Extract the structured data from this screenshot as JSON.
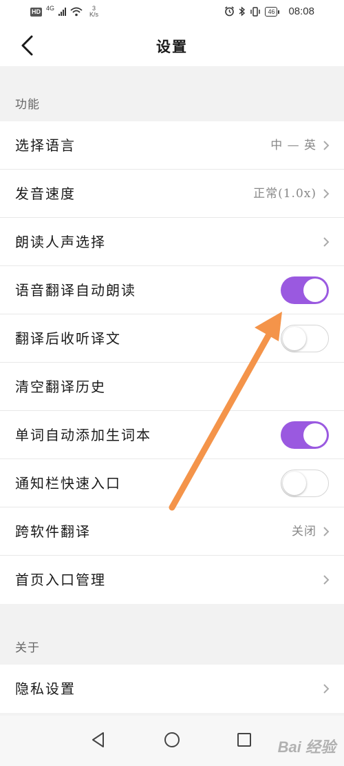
{
  "status_bar": {
    "hd": "HD",
    "network": "4G",
    "speed_value": "3",
    "speed_unit": "K/s",
    "battery": "46",
    "time": "08:08"
  },
  "header": {
    "title": "设置"
  },
  "sections": [
    {
      "title": "功能",
      "items": [
        {
          "label": "选择语言",
          "value": "中 — 英",
          "chevron": true
        },
        {
          "label": "发音速度",
          "value": "正常(1.0x)",
          "chevron": true
        },
        {
          "label": "朗读人声选择",
          "value": "",
          "chevron": true
        },
        {
          "label": "语音翻译自动朗读",
          "toggle": true,
          "on": true
        },
        {
          "label": "翻译后收听译文",
          "toggle": true,
          "on": false
        },
        {
          "label": "清空翻译历史"
        },
        {
          "label": "单词自动添加生词本",
          "toggle": true,
          "on": true
        },
        {
          "label": "通知栏快速入口",
          "toggle": true,
          "on": false
        },
        {
          "label": "跨软件翻译",
          "value": "关闭",
          "chevron": true
        },
        {
          "label": "首页入口管理",
          "value": "",
          "chevron": true
        }
      ]
    },
    {
      "title": "关于",
      "items": [
        {
          "label": "隐私设置",
          "value": "",
          "chevron": true
        }
      ]
    }
  ],
  "colors": {
    "toggle_on": "#9a59e0",
    "annotation_arrow": "#f4944a"
  },
  "nav_icons": [
    "back-triangle-icon",
    "home-circle-icon",
    "recents-square-icon"
  ],
  "watermark": "Bai 经验"
}
